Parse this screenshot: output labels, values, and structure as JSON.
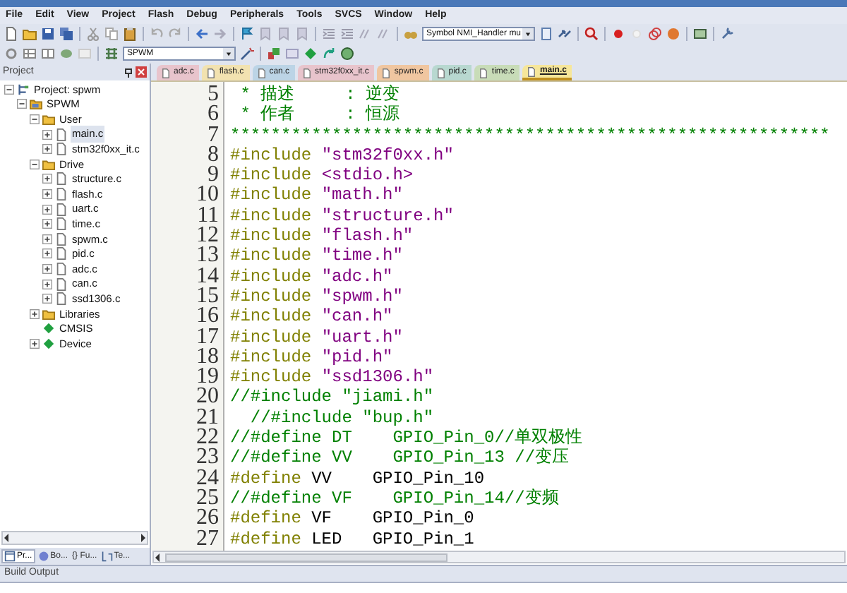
{
  "menu": [
    "File",
    "Edit",
    "View",
    "Project",
    "Flash",
    "Debug",
    "Peripherals",
    "Tools",
    "SVCS",
    "Window",
    "Help"
  ],
  "toolbar": {
    "symbol_combo": "Symbol NMI_Handler mu",
    "target_combo": "SPWM"
  },
  "project_panel": {
    "title": "Project",
    "tree": [
      {
        "label": "Project: spwm",
        "kind": "project",
        "expanded": true,
        "selected": false,
        "children": [
          {
            "label": "SPWM",
            "kind": "target",
            "expanded": true,
            "selected": false,
            "children": [
              {
                "label": "User",
                "kind": "folder",
                "expanded": true,
                "selected": false,
                "children": [
                  {
                    "label": "main.c",
                    "kind": "file",
                    "expanded": false,
                    "selected": true
                  },
                  {
                    "label": "stm32f0xx_it.c",
                    "kind": "file",
                    "expanded": false,
                    "selected": false
                  }
                ]
              },
              {
                "label": "Drive",
                "kind": "folder",
                "expanded": true,
                "selected": false,
                "children": [
                  {
                    "label": "structure.c",
                    "kind": "file",
                    "expanded": false,
                    "selected": false
                  },
                  {
                    "label": "flash.c",
                    "kind": "file",
                    "expanded": false,
                    "selected": false
                  },
                  {
                    "label": "uart.c",
                    "kind": "file",
                    "expanded": false,
                    "selected": false
                  },
                  {
                    "label": "time.c",
                    "kind": "file",
                    "expanded": false,
                    "selected": false
                  },
                  {
                    "label": "spwm.c",
                    "kind": "file",
                    "expanded": false,
                    "selected": false
                  },
                  {
                    "label": "pid.c",
                    "kind": "file",
                    "expanded": false,
                    "selected": false
                  },
                  {
                    "label": "adc.c",
                    "kind": "file",
                    "expanded": false,
                    "selected": false
                  },
                  {
                    "label": "can.c",
                    "kind": "file",
                    "expanded": false,
                    "selected": false
                  },
                  {
                    "label": "ssd1306.c",
                    "kind": "file",
                    "expanded": false,
                    "selected": false
                  }
                ]
              },
              {
                "label": "Libraries",
                "kind": "folder",
                "expanded": false,
                "selected": false
              },
              {
                "label": "CMSIS",
                "kind": "component",
                "selected": false
              },
              {
                "label": "Device",
                "kind": "component",
                "expanded": false,
                "selected": false
              }
            ]
          }
        ]
      }
    ],
    "tabs": [
      {
        "label": "Pr...",
        "selected": true
      },
      {
        "label": "Bo...",
        "selected": false
      },
      {
        "label": "{} Fu...",
        "selected": false
      },
      {
        "label": "Te...",
        "selected": false
      }
    ]
  },
  "editor_tabs": [
    {
      "label": "adc.c",
      "color": "#e8c4cc",
      "selected": false
    },
    {
      "label": "flash.c",
      "color": "#f2e2b0",
      "selected": false
    },
    {
      "label": "can.c",
      "color": "#bcd4e6",
      "selected": false
    },
    {
      "label": "stm32f0xx_it.c",
      "color": "#e8c4cc",
      "selected": false
    },
    {
      "label": "spwm.c",
      "color": "#f0c6a0",
      "selected": false
    },
    {
      "label": "pid.c",
      "color": "#b8d8d0",
      "selected": false
    },
    {
      "label": "time.c",
      "color": "#c8dcb8",
      "selected": false
    },
    {
      "label": "main.c",
      "color": "#f6e69a",
      "selected": true
    }
  ],
  "code_lines": [
    {
      "number": "5",
      "tokens": [
        {
          "kind": "comment",
          "text": " * 描述     : 逆变"
        }
      ]
    },
    {
      "number": "6",
      "tokens": [
        {
          "kind": "comment",
          "text": " * 作者     : 恒源"
        }
      ]
    },
    {
      "number": "7",
      "tokens": [
        {
          "kind": "comment",
          "text": "***********************************************************"
        }
      ]
    },
    {
      "number": "8",
      "tokens": [
        {
          "kind": "directive",
          "text": "#include "
        },
        {
          "kind": "string",
          "text": "\"stm32f0xx.h\""
        }
      ]
    },
    {
      "number": "9",
      "tokens": [
        {
          "kind": "directive",
          "text": "#include "
        },
        {
          "kind": "string",
          "text": "<stdio.h>"
        }
      ]
    },
    {
      "number": "10",
      "tokens": [
        {
          "kind": "directive",
          "text": "#include "
        },
        {
          "kind": "string",
          "text": "\"math.h\""
        }
      ]
    },
    {
      "number": "11",
      "tokens": [
        {
          "kind": "directive",
          "text": "#include "
        },
        {
          "kind": "string",
          "text": "\"structure.h\""
        }
      ]
    },
    {
      "number": "12",
      "tokens": [
        {
          "kind": "directive",
          "text": "#include "
        },
        {
          "kind": "string",
          "text": "\"flash.h\""
        }
      ]
    },
    {
      "number": "13",
      "tokens": [
        {
          "kind": "directive",
          "text": "#include "
        },
        {
          "kind": "string",
          "text": "\"time.h\""
        }
      ]
    },
    {
      "number": "14",
      "tokens": [
        {
          "kind": "directive",
          "text": "#include "
        },
        {
          "kind": "string",
          "text": "\"adc.h\""
        }
      ]
    },
    {
      "number": "15",
      "tokens": [
        {
          "kind": "directive",
          "text": "#include "
        },
        {
          "kind": "string",
          "text": "\"spwm.h\""
        }
      ]
    },
    {
      "number": "16",
      "tokens": [
        {
          "kind": "directive",
          "text": "#include "
        },
        {
          "kind": "string",
          "text": "\"can.h\""
        }
      ]
    },
    {
      "number": "17",
      "tokens": [
        {
          "kind": "directive",
          "text": "#include "
        },
        {
          "kind": "string",
          "text": "\"uart.h\""
        }
      ]
    },
    {
      "number": "18",
      "tokens": [
        {
          "kind": "directive",
          "text": "#include "
        },
        {
          "kind": "string",
          "text": "\"pid.h\""
        }
      ]
    },
    {
      "number": "19",
      "tokens": [
        {
          "kind": "directive",
          "text": "#include "
        },
        {
          "kind": "string",
          "text": "\"ssd1306.h\""
        }
      ]
    },
    {
      "number": "20",
      "tokens": [
        {
          "kind": "comment",
          "text": "//#include \"jiami.h\""
        }
      ]
    },
    {
      "number": "21",
      "tokens": [
        {
          "kind": "comment",
          "text": "  //#include \"bup.h\""
        }
      ]
    },
    {
      "number": "22",
      "tokens": [
        {
          "kind": "comment",
          "text": "//#define DT    GPIO_Pin_0//单双极性"
        }
      ]
    },
    {
      "number": "23",
      "tokens": [
        {
          "kind": "comment",
          "text": "//#define VV    GPIO_Pin_13 //变压"
        }
      ]
    },
    {
      "number": "24",
      "tokens": [
        {
          "kind": "directive",
          "text": "#define "
        },
        {
          "kind": "plain",
          "text": "VV    GPIO_Pin_10"
        }
      ]
    },
    {
      "number": "25",
      "tokens": [
        {
          "kind": "comment",
          "text": "//#define VF    GPIO_Pin_14//变频"
        }
      ]
    },
    {
      "number": "26",
      "tokens": [
        {
          "kind": "directive",
          "text": "#define "
        },
        {
          "kind": "plain",
          "text": "VF    GPIO_Pin_0"
        }
      ]
    },
    {
      "number": "27",
      "tokens": [
        {
          "kind": "directive",
          "text": "#define "
        },
        {
          "kind": "plain",
          "text": "LED   GPIO_Pin_1"
        }
      ]
    }
  ],
  "build_output": {
    "title": "Build Output"
  }
}
